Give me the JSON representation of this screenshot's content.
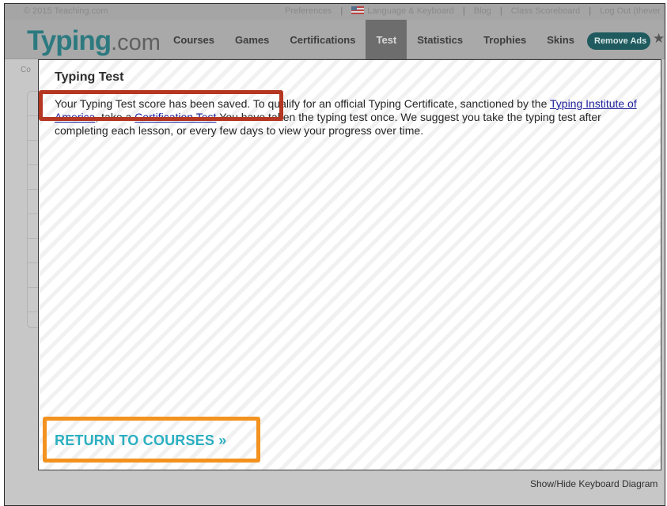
{
  "topbar": {
    "copyright": "© 2015 Teaching.com",
    "links": [
      "Preferences",
      "Language & Keyboard",
      "Blog",
      "Class Scoreboard",
      "Log Out (thever"
    ],
    "separator": "|"
  },
  "nav": {
    "logo_main": "Typing",
    "logo_suffix": ".com",
    "items": [
      "Courses",
      "Games",
      "Certifications",
      "Test",
      "Statistics",
      "Trophies",
      "Skins"
    ],
    "active": "Test",
    "remove_ads": "Remove Ads",
    "star": "★"
  },
  "background": {
    "crumb": "Co",
    "right_crumb": "ar"
  },
  "modal": {
    "title": "Typing Test",
    "body_part1": "Your Typing Test score has been saved. To qualify for an official Typing Certificate, sanctioned by the ",
    "link1": "Typing Institute of America",
    "body_part2": ", take a ",
    "link2": "Certification Test",
    "body_part3": ".You have taken the typing test once. We suggest you take the typing test after completing each lesson, or every few days to view your progress over time.",
    "return_link": "RETURN TO COURSES »"
  },
  "footer": {
    "keyboard_toggle": "Show/Hide Keyboard Diagram"
  },
  "colors": {
    "logo": "#2c7a80",
    "active_tab": "#6d6d6d",
    "remove_ads_bg": "#1f5a5e",
    "link": "#1c1f9a",
    "return_link": "#2bafc1",
    "highlight_red": "#b53621",
    "highlight_orange": "#f3921f"
  }
}
